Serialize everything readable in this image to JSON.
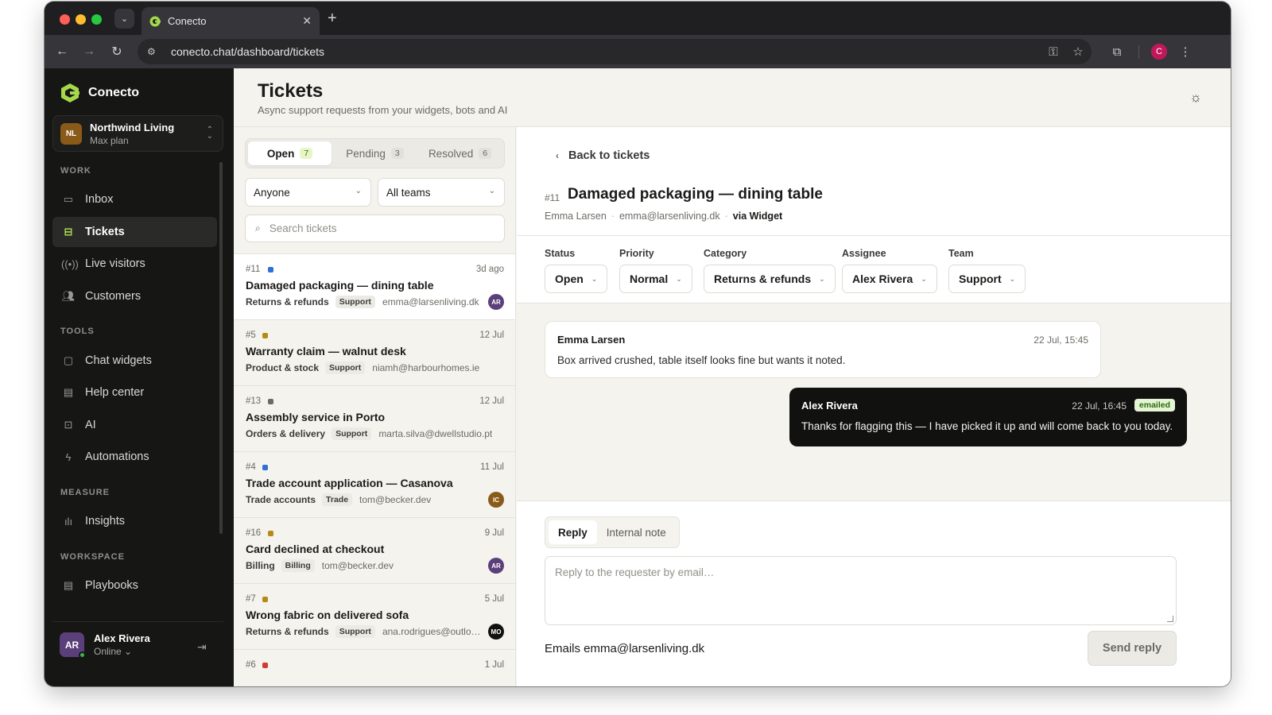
{
  "browser": {
    "tab_title": "Conecto",
    "url": "conecto.chat/dashboard/tickets",
    "profile_initial": "C"
  },
  "sidebar": {
    "brand": "Conecto",
    "org": {
      "initials": "NL",
      "name": "Northwind Living",
      "plan": "Max plan"
    },
    "sections": {
      "work": "WORK",
      "tools": "TOOLS",
      "measure": "MEASURE",
      "workspace": "WORKSPACE"
    },
    "items": {
      "inbox": "Inbox",
      "tickets": "Tickets",
      "live_visitors": "Live visitors",
      "customers": "Customers",
      "chat_widgets": "Chat widgets",
      "help_center": "Help center",
      "ai": "AI",
      "automations": "Automations",
      "insights": "Insights",
      "playbooks": "Playbooks"
    },
    "user": {
      "initials": "AR",
      "name": "Alex Rivera",
      "status": "Online"
    }
  },
  "header": {
    "title": "Tickets",
    "subtitle": "Async support requests from your widgets, bots and AI"
  },
  "list": {
    "tabs": [
      {
        "label": "Open",
        "count": "7"
      },
      {
        "label": "Pending",
        "count": "3"
      },
      {
        "label": "Resolved",
        "count": "6"
      }
    ],
    "assignee_filter": "Anyone",
    "team_filter": "All teams",
    "search_placeholder": "Search tickets",
    "tickets": [
      {
        "num": "#11",
        "prio_color": "#2f6fd6",
        "time": "3d ago",
        "title": "Damaged packaging — dining table",
        "category": "Returns & refunds",
        "team": "Support",
        "email": "emma@larsenliving.dk",
        "avatar": "AR",
        "avatar_color": "#5b3f7a"
      },
      {
        "num": "#5",
        "prio_color": "#b58a17",
        "time": "12 Jul",
        "title": "Warranty claim — walnut desk",
        "category": "Product & stock",
        "team": "Support",
        "email": "niamh@harbourhomes.ie",
        "avatar": "",
        "avatar_color": ""
      },
      {
        "num": "#13",
        "prio_color": "#6b6b66",
        "time": "12 Jul",
        "title": "Assembly service in Porto",
        "category": "Orders & delivery",
        "team": "Support",
        "email": "marta.silva@dwellstudio.pt",
        "avatar": "",
        "avatar_color": ""
      },
      {
        "num": "#4",
        "prio_color": "#2f6fd6",
        "time": "11 Jul",
        "title": "Trade account application — Casanova",
        "category": "Trade accounts",
        "team": "Trade",
        "email": "tom@becker.dev",
        "avatar": "IC",
        "avatar_color": "#8a5a19"
      },
      {
        "num": "#16",
        "prio_color": "#b58a17",
        "time": "9 Jul",
        "title": "Card declined at checkout",
        "category": "Billing",
        "team": "Billing",
        "email": "tom@becker.dev",
        "avatar": "AR",
        "avatar_color": "#5b3f7a"
      },
      {
        "num": "#7",
        "prio_color": "#b58a17",
        "time": "5 Jul",
        "title": "Wrong fabric on delivered sofa",
        "category": "Returns & refunds",
        "team": "Support",
        "email": "ana.rodrigues@outlook.com",
        "avatar": "MO",
        "avatar_color": "#111110"
      },
      {
        "num": "#6",
        "prio_color": "#d43a2f",
        "time": "1 Jul",
        "title": "",
        "category": "",
        "team": "",
        "email": "",
        "avatar": "",
        "avatar_color": ""
      }
    ]
  },
  "detail": {
    "back_label": "Back to tickets",
    "num": "#11",
    "title": "Damaged packaging — dining table",
    "requester": "Emma Larsen",
    "email": "emma@larsenliving.dk",
    "via": "via Widget",
    "fields": {
      "status": {
        "label": "Status",
        "value": "Open"
      },
      "priority": {
        "label": "Priority",
        "value": "Normal"
      },
      "category": {
        "label": "Category",
        "value": "Returns & refunds"
      },
      "assignee": {
        "label": "Assignee",
        "value": "Alex Rivera"
      },
      "team": {
        "label": "Team",
        "value": "Support"
      }
    },
    "messages": [
      {
        "author": "Emma Larsen",
        "time": "22 Jul, 15:45",
        "body": "Box arrived crushed, table itself looks fine but wants it noted."
      },
      {
        "author": "Alex Rivera",
        "time": "22 Jul, 16:45",
        "badge": "emailed",
        "body": "Thanks for flagging this — I have picked it up and will come back to you today."
      }
    ],
    "reply": {
      "tab_reply": "Reply",
      "tab_note": "Internal note",
      "placeholder": "Reply to the requester by email…",
      "emails_note": "Emails emma@larsenliving.dk",
      "send_label": "Send reply"
    }
  },
  "colors": {
    "accent_green": "#a5d84a",
    "sidebar_bg": "#161615",
    "page_bg": "#f4f3ee"
  }
}
